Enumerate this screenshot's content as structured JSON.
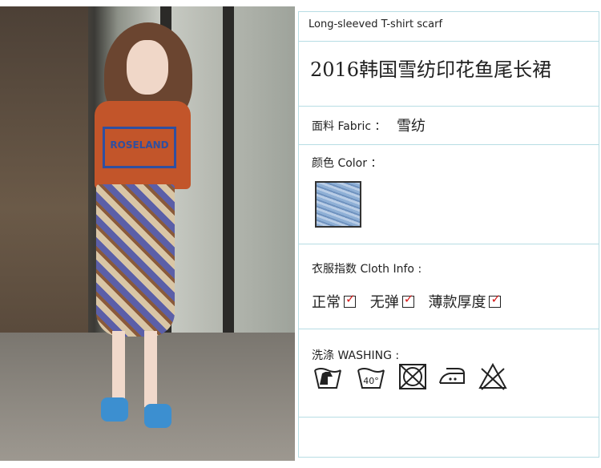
{
  "product": {
    "subtitle": "Long-sleeved T-shirt scarf",
    "title": "2016韩国雪纺印花鱼尾长裙"
  },
  "fabric": {
    "label": "面料 Fabric ：",
    "value": "雪纺"
  },
  "color": {
    "label": "颜色 Color ：",
    "swatch_color": "#9bb5d9"
  },
  "cloth_info": {
    "label": "衣服指数 Cloth Info :",
    "items": [
      {
        "label": "正常",
        "checked": true
      },
      {
        "label": "无弹",
        "checked": true
      },
      {
        "label": "薄款厚度",
        "checked": true
      }
    ]
  },
  "washing": {
    "label": "洗涤 WASHING :",
    "icons": [
      "hand-wash-icon",
      "wash-40-icon",
      "do-not-tumble-dry-icon",
      "iron-low-icon",
      "do-not-bleach-icon"
    ],
    "temp": "40°"
  },
  "photo": {
    "print_text": "ROSELAND"
  },
  "colors": {
    "border": "#b7dde4",
    "check": "#d41a1a"
  }
}
